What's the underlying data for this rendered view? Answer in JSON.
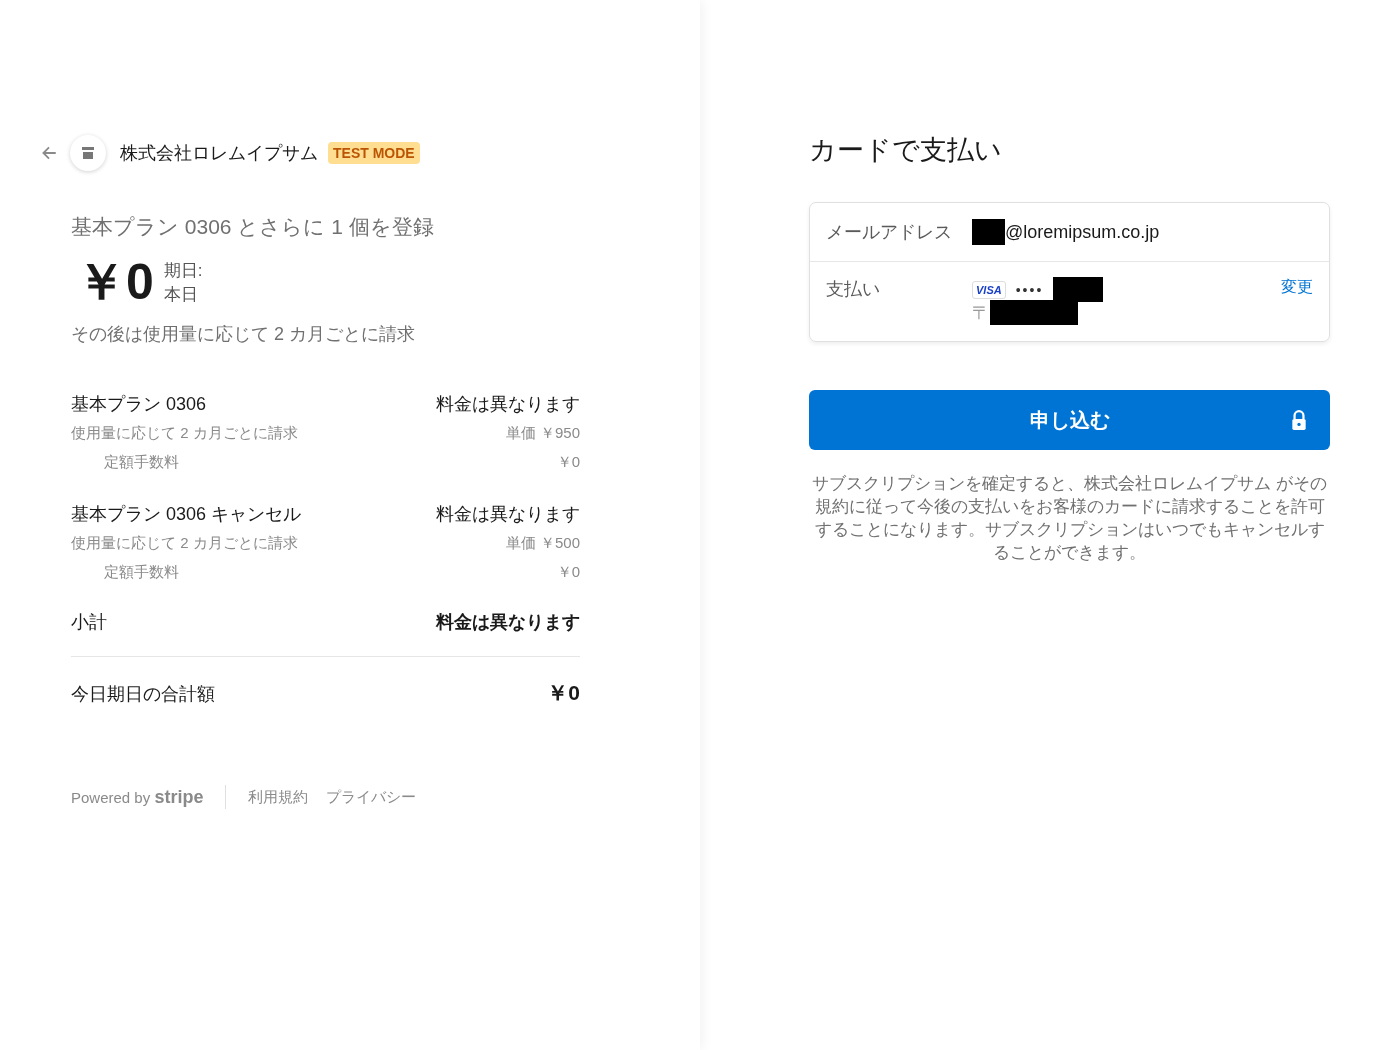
{
  "merchant": {
    "name": "株式会社ロレムイプサム",
    "badge": "TEST MODE"
  },
  "summary": {
    "title": "基本プラン 0306 とさらに 1 個を登録",
    "amount": "￥0",
    "due_label": "期日:",
    "due_value": "本日",
    "note": "その後は使用量に応じて 2 カ月ごとに請求"
  },
  "line_items": [
    {
      "name": "基本プラン 0306",
      "price": "料金は異なります",
      "description": "使用量に応じて 2 カ月ごとに請求",
      "unit_price": "単価 ￥950",
      "fee_label": "定額手数料",
      "fee": "￥0"
    },
    {
      "name": "基本プラン 0306 キャンセル",
      "price": "料金は異なります",
      "description": "使用量に応じて 2 カ月ごとに請求",
      "unit_price": "単価 ￥500",
      "fee_label": "定額手数料",
      "fee": "￥0"
    }
  ],
  "subtotal": {
    "label": "小計",
    "value": "料金は異なります"
  },
  "total": {
    "label": "今日期日の合計額",
    "value": "￥0"
  },
  "footer": {
    "powered_by": "Powered by",
    "brand": "stripe",
    "links": [
      "利用規約",
      "プライバシー"
    ]
  },
  "payment": {
    "title": "カードで支払い",
    "email_label": "メールアドレス",
    "email_value": "@loremipsum.co.jp",
    "payment_label": "支払い",
    "card_brand": "VISA",
    "card_dots": "••••",
    "postal_mark": "〒",
    "change_link": "変更"
  },
  "submit": {
    "label": "申し込む"
  },
  "terms": "サブスクリプションを確定すると、株式会社ロレムイプサム がその規約に従って今後の支払いをお客様のカードに請求することを許可することになります。サブスクリプションはいつでもキャンセルすることができます。"
}
